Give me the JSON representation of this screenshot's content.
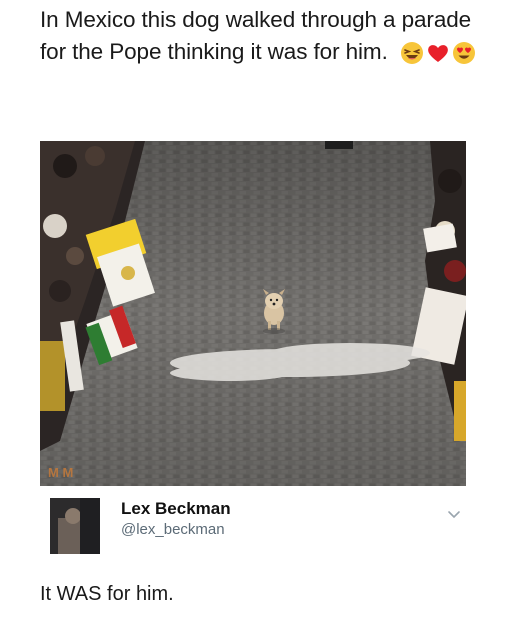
{
  "caption": {
    "text": "In Mexico this dog walked through a parade for the Pope thinking it was for him.",
    "emojis": [
      "laughing-emoji",
      "heart-emoji",
      "heart-eyes-emoji"
    ]
  },
  "photo": {
    "watermark": "M M"
  },
  "tweet": {
    "display_name": "Lex Beckman",
    "handle": "@lex_beckman",
    "text": "It WAS for him."
  },
  "colors": {
    "street": "#6e6c6a",
    "flag_green": "#2e7d32",
    "flag_red": "#c62828",
    "vatican_yellow": "#f2cf2e",
    "handle_gray": "#5c6b77"
  }
}
